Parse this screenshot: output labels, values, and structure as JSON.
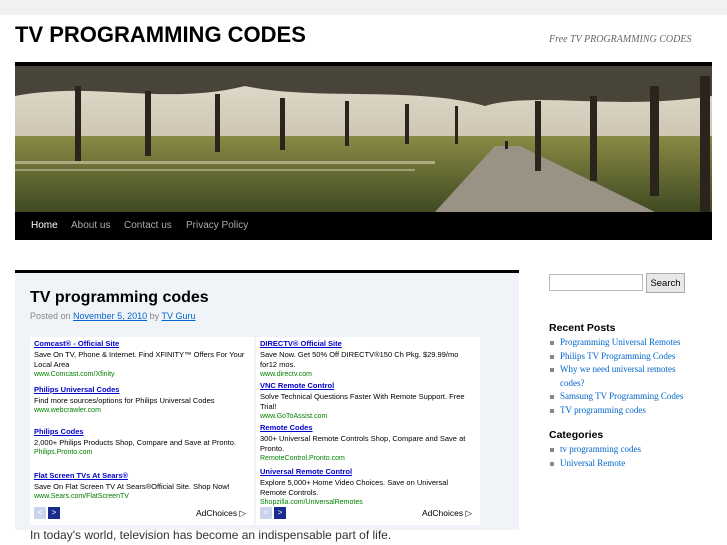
{
  "header": {
    "title": "TV PROGRAMMING CODES",
    "description": "Free TV PROGRAMMING CODES"
  },
  "nav": {
    "items": [
      "Home",
      "About us",
      "Contact us",
      "Privacy Policy"
    ]
  },
  "post": {
    "title": "TV programming codes",
    "posted_on": "Posted on",
    "date": "November 5, 2010",
    "by": "by",
    "author": "TV Guru",
    "text": "In today's world, television has become an indispensable part of life."
  },
  "ads": {
    "left": [
      {
        "title": "Comcast® - Official Site",
        "desc": "Save On TV, Phone & Internet. Find XFINITY™ Offers For Your Local Area",
        "url": "www.Comcast.com/Xfinity"
      },
      {
        "title": "Philips Universal Codes",
        "desc": "Find more sources/options for Philips Universal Codes",
        "url": "www.webcrawler.com"
      },
      {
        "title": "Philips Codes",
        "desc": "2,000+ Philips Products Shop, Compare and Save at Pronto.",
        "url": "Philips.Pronto.com"
      },
      {
        "title": "Flat Screen TVs At Sears®",
        "desc": "Save On Flat Screen TV At Sears®Official Site. Shop Now!",
        "url": "www.Sears.com/FlatScreenTV"
      }
    ],
    "right": [
      {
        "title": "DIRECTV® Official Site",
        "desc": "Save Now. Get 50% Off DIRECTV®150 Ch Pkg. $29.99/mo for12 mos.",
        "url": "www.directv.com"
      },
      {
        "title": "VNC Remote Control",
        "desc": "Solve Technical Questions Faster With Remote Support. Free Trial!",
        "url": "www.GoToAssist.com"
      },
      {
        "title": "Remote Codes",
        "desc": "300+ Universal Remote Controls Shop, Compare and Save at Pronto.",
        "url": "RemoteControl.Pronto.com"
      },
      {
        "title": "Universal Remote Control",
        "desc": "Explore 5,000+ Home Video Choices. Save on Universal Remote Controls.",
        "url": "Shopzilla.com/UniversalRemotes"
      }
    ],
    "adchoices": "AdChoices ▷",
    "prev_arrow": "<",
    "next_arrow": ">"
  },
  "sidebar": {
    "search_button": "Search",
    "recent_posts_title": "Recent Posts",
    "recent_posts": [
      "Programming Universal Remotes",
      "Philips TV Programming Codes",
      "Why we need universal remotes codes?",
      "Samsung TV Programming Codes",
      "TV programming codes"
    ],
    "categories_title": "Categories",
    "categories": [
      "tv programming codes",
      "Universal Remote"
    ]
  },
  "colors": {
    "accent": "#000000",
    "link": "#0066cc",
    "post_bg": "#f0f3f7"
  }
}
